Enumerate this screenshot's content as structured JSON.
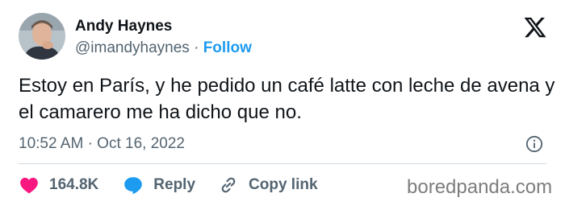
{
  "author": {
    "name": "Andy Haynes",
    "handle": "@imandyhaynes",
    "separator": "·",
    "follow_label": "Follow"
  },
  "tweet": {
    "text": "Estoy en París, y he pedido un café latte con leche de avena y el camarero me ha dicho que no.",
    "time": "10:52 AM",
    "meta_separator": "·",
    "date": "Oct 16, 2022"
  },
  "actions": {
    "like_count": "164.8K",
    "reply_label": "Reply",
    "copy_link_label": "Copy link"
  },
  "icons": {
    "platform": "x-logo-icon",
    "info": "info-icon",
    "like": "heart-icon",
    "reply": "speech-bubble-icon",
    "copy_link": "link-icon"
  },
  "colors": {
    "accent": "#1d9bf0",
    "like": "#f91880",
    "text": "#0f1419",
    "muted": "#536471"
  },
  "watermark": "boredpanda.com"
}
